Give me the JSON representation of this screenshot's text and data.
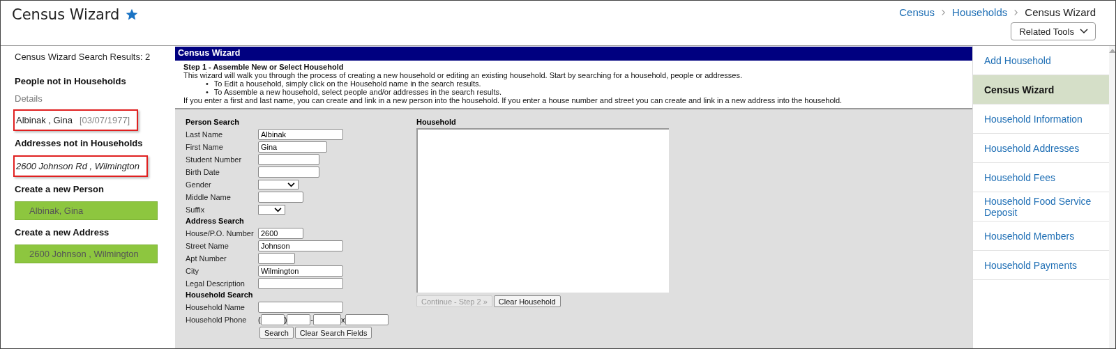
{
  "header": {
    "title": "Census Wizard",
    "favorite": true,
    "breadcrumbs": [
      {
        "label": "Census",
        "link": true
      },
      {
        "label": "Households",
        "link": true
      },
      {
        "label": "Census Wizard",
        "link": false
      }
    ],
    "related_tools": "Related Tools"
  },
  "results": {
    "summary": "Census Wizard Search Results: 2",
    "sections": [
      {
        "kind": "list",
        "heading": "People not in Households",
        "subheading": "Details",
        "items": [
          {
            "text": "Albinak , Gina",
            "detail": "[03/07/1977]",
            "italic": false,
            "highlighted": true
          }
        ]
      },
      {
        "kind": "list",
        "heading": "Addresses not in Households",
        "items": [
          {
            "text": "2600 Johnson Rd , Wilmington",
            "italic": true,
            "highlighted": true
          }
        ]
      },
      {
        "kind": "create",
        "heading": "Create a new Person",
        "button": "Albinak, Gina"
      },
      {
        "kind": "create",
        "heading": "Create a new Address",
        "button": "2600 Johnson , Wilmington"
      }
    ]
  },
  "wizard": {
    "title": "Census Wizard",
    "step": "Step 1 - Assemble New or Select Household",
    "intro": "This wizard will walk you through the process of creating a new household or editing an existing household. Start by searching for a household, people or addresses.",
    "bullets": [
      {
        "marker": "•",
        "text": "To Edit a household, simply click on the Household name in the search results."
      },
      {
        "marker": "•",
        "text": "To Assemble a new household, select people and/or addresses in the search results."
      }
    ],
    "note": "If you enter a first and last name, you can create and link in a new person into the household. If you enter a house number and street you can create and link in a new address into the household.",
    "form": [
      {
        "kind": "heading",
        "label": "Person Search"
      },
      {
        "kind": "text",
        "label": "Last Name",
        "value": "Albinak"
      },
      {
        "kind": "text",
        "label": "First Name",
        "value": "Gina"
      },
      {
        "kind": "text",
        "label": "Student Number"
      },
      {
        "kind": "text",
        "label": "Birth Date"
      },
      {
        "kind": "select",
        "label": "Gender"
      },
      {
        "kind": "text",
        "label": "Middle Name"
      },
      {
        "kind": "select",
        "label": "Suffix"
      },
      {
        "kind": "heading",
        "label": "Address Search"
      },
      {
        "kind": "text",
        "label": "House/P.O. Number",
        "value": "2600"
      },
      {
        "kind": "text",
        "label": "Street Name",
        "value": "Johnson"
      },
      {
        "kind": "text",
        "label": "Apt Number"
      },
      {
        "kind": "text",
        "label": "City",
        "value": "Wilmington"
      },
      {
        "kind": "text",
        "label": "Legal Description"
      },
      {
        "kind": "heading",
        "label": "Household Search"
      },
      {
        "kind": "text",
        "label": "Household Name"
      },
      {
        "kind": "phone",
        "label": "Household Phone",
        "separators": [
          "(",
          ")",
          "-",
          "x"
        ]
      }
    ],
    "search_buttons": [
      "Search",
      "Clear Search Fields"
    ],
    "household": {
      "label": "Household",
      "continue": {
        "label": "Continue - Step 2 »",
        "disabled": true
      },
      "clear": {
        "label": "Clear Household",
        "disabled": false
      }
    }
  },
  "nav": [
    {
      "label": "Add Household",
      "selected": false
    },
    {
      "label": "Census Wizard",
      "selected": true
    },
    {
      "label": "Household Information",
      "selected": false
    },
    {
      "label": "Household Addresses",
      "selected": false
    },
    {
      "label": "Household Fees",
      "selected": false
    },
    {
      "label": "Household Food Service Deposit",
      "selected": false
    },
    {
      "label": "Household Members",
      "selected": false
    },
    {
      "label": "Household Payments",
      "selected": false
    }
  ]
}
